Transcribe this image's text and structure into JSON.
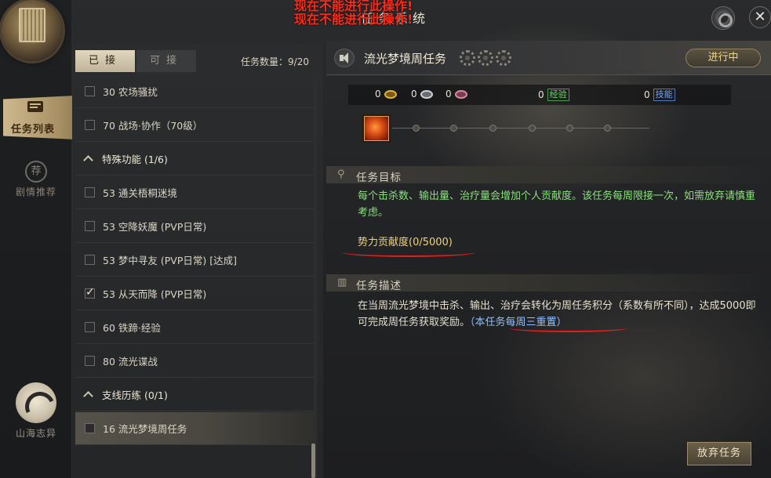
{
  "window": {
    "title": "任务系统",
    "warning_line1": "现在不能进行此操作!",
    "warning_line2": "现在不能进行此操作!"
  },
  "rail": {
    "active_label": "任务列表",
    "story_glyph": "荐",
    "story_label": "剧情推荐",
    "shanhai_label": "山海志异"
  },
  "list": {
    "tab_accepted": "已接",
    "tab_available": "可接",
    "task_count": "任务数量：9/20",
    "items": [
      {
        "kind": "task",
        "text": "30 农场骚扰",
        "checked": false
      },
      {
        "kind": "task",
        "text": "70 战场·协作（70级）",
        "checked": false
      },
      {
        "kind": "header",
        "text": "特殊功能 (1/6)"
      },
      {
        "kind": "task",
        "text": "53 通关梧桐迷境",
        "checked": false
      },
      {
        "kind": "task",
        "text": "53 空降妖魔 (PVP日常)",
        "checked": false
      },
      {
        "kind": "task",
        "text": "53 梦中寻友 (PVP日常) [达成]",
        "checked": false
      },
      {
        "kind": "task",
        "text": "53 从天而降 (PVP日常)",
        "checked": true
      },
      {
        "kind": "task",
        "text": "60 铁蹄·经验",
        "checked": false
      },
      {
        "kind": "task",
        "text": "80 流光谍战",
        "checked": false
      },
      {
        "kind": "header",
        "text": "支线历练 (0/1)"
      },
      {
        "kind": "task",
        "text": "16 流光梦境周任务",
        "checked": false,
        "selected": true
      }
    ]
  },
  "detail": {
    "task_name": "流光梦境周任务",
    "status": "进行中",
    "rewards": {
      "gold": "0",
      "silver": "0",
      "rose": "0",
      "exp": "0",
      "exp_tag": "经验",
      "skill": "0",
      "skill_tag": "技能"
    },
    "goal_heading": "任务目标",
    "goal_text": "每个击杀数、输出量、治疗量会增加个人贡献度。该任务每周限接一次，如需放弃请慎重考虑。",
    "goal_progress": "势力贡献度(0/5000)",
    "desc_heading": "任务描述",
    "desc_text": "在当周流光梦境中击杀、输出、治疗会转化为周任务积分（系数有所不同），达成5000即可完成周任务获取奖励。",
    "desc_reset": "（本任务每周三重置）",
    "abandon_label": "放弃任务"
  },
  "colors": {
    "goal_green": "#8be07e",
    "progress_gold": "#f0d27a",
    "warning_red": "#ff2a1a",
    "reset_blue": "#8fc0ff"
  }
}
